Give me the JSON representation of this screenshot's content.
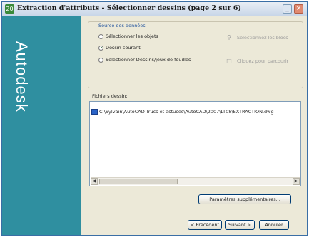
{
  "window": {
    "title_icon": "20",
    "title": "Extraction d'attributs - Sélectionner dessins (page 2 sur 6)",
    "minimize_label": "_",
    "close_label": "×"
  },
  "sidebar": {
    "brand": "Autodesk",
    "color": "#2f8fa0"
  },
  "source_group": {
    "label": "Source des données",
    "options": [
      {
        "label": "Sélectionner les objets",
        "selected": false
      },
      {
        "label": "Dessin courant",
        "selected": true
      },
      {
        "label": "Sélectionner Dessins/jeux de feuilles",
        "selected": false
      }
    ],
    "select_objects_action": "Sélectionnez les blocs",
    "browse_action": "Cliquez pour parcourir"
  },
  "files": {
    "label": "Fichiers dessin:",
    "rows": [
      "C:\\Sylvain\\AutoCAD Trucs et astuces\\AutoCAD\\2007\\LT08\\EXTRACTION.dwg"
    ]
  },
  "buttons": {
    "additional_settings": "Paramètres supplémentaires...",
    "previous": "< Précédent",
    "next": "Suivant >",
    "cancel": "Annuler"
  },
  "icons": {
    "radio_selected_color": "#2a6a2a"
  }
}
